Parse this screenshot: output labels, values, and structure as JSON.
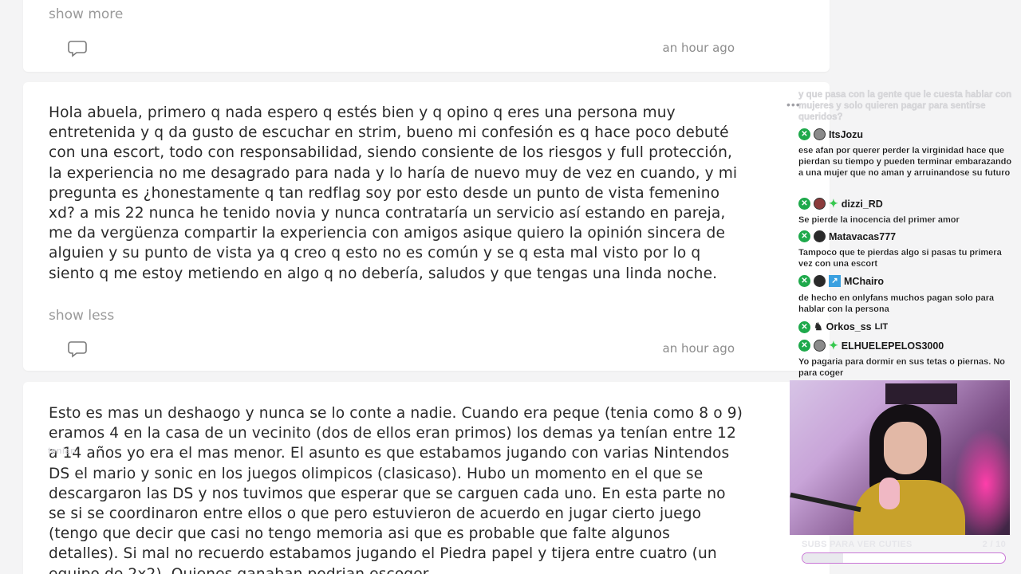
{
  "posts": [
    {
      "text": "",
      "toggle": "show more",
      "time": "an hour ago"
    },
    {
      "text": "Hola abuela, primero q nada espero q estés bien y q opino q eres una persona muy entretenida y q da gusto de escuchar en strim, bueno mi confesión es q hace poco debuté con una escort, todo con responsabilidad, siendo consiente de los riesgos y full protección, la experiencia no me desagrado para nada y lo haría de nuevo muy de vez en cuando, y mi pregunta es ¿honestamente q tan redflag soy por esto desde un punto de vista femenino xd? a mis 22 nunca he tenido novia y nunca contrataría un servicio así estando en pareja, me da vergüenza compartir la experiencia con amigos asique quiero la opinión sincera de alguien y su punto de vista ya q creo q esto no es común y se q esta mal visto por lo q siento q me estoy metiendo en algo q no debería, saludos y que tengas una linda noche.",
      "toggle": "show less",
      "time": "an hour ago"
    },
    {
      "text": "Esto es mas un deshaogo y nunca se lo conte a nadie. Cuando era peque (tenia como 8 o 9) eramos 4 en la casa de un vecinito (dos de ellos eran primos) los demas ya tenían entre 12 a 14 años yo era el mas menor. El asunto es que estabamos jugando con varias Nintendos DS el mario y sonic en los juegos olimpicos (clasicaso). Hubo un momento en el que se descargaron las DS y nos tuvimos que esperar que se carguen cada uno. En esta parte no se si se coordinaron entre ellos o que pero estuvieron de acuerdo en jugar cierto juego (tengo que decir que casi no tengo memoria asi que es probable que falte algunos detalles). Si mal no recuerdo estabamos jugando el Piedra papel y tijera entre cuatro (un equipo de 2x2). Quienes ganaban podrian escoger"
    }
  ],
  "overlay_tag": "tenían",
  "chat": {
    "faded_message": "y que pasa con la gente que le cuesta hablar con mujeres y solo quieren pagar para sentirse queridos?",
    "dots": "•••",
    "messages": [
      {
        "user": "ItsJozu",
        "text": "ese afan por querer perder la virginidad hace que pierdan su tiempo y pueden terminar embarazando a una mujer que no aman y arruinandose su futuro",
        "avatar": "gray",
        "extra": ""
      },
      {
        "user": "dizzi_RD",
        "text": "Se pierde la inocencia del primer amor",
        "avatar": "red",
        "extra": "spark"
      },
      {
        "user": "Matavacas777",
        "text": "Tampoco que te pierdas algo si pasas tu primera vez con una escort",
        "avatar": "dark",
        "extra": ""
      },
      {
        "user": "MChairo",
        "text": "de hecho en onlyfans muchos pagan solo para hablar con la persona",
        "avatar": "dark",
        "extra": "blue"
      },
      {
        "user": "Orkos_ss",
        "text": "",
        "avatar": "",
        "extra": "sil",
        "suffix": "LIT"
      },
      {
        "user": "ELHUELEPELOS3000",
        "text": "Yo pagaria para dormir en sus tetas o piernas. No para coger",
        "avatar": "gray",
        "extra": "spark"
      }
    ]
  },
  "goal": {
    "label": "SUBS PARA VER CUTIES",
    "count": "2 / 10",
    "progress": 0.2
  },
  "colors": {
    "page_bg": "#f4f4f5",
    "card_bg": "#ffffff",
    "text": "#2a2a2a",
    "muted": "#8d8d8d",
    "badge_green": "#1ea94b",
    "goal_border": "#c977d6"
  },
  "icons": {
    "comment": "comment-bubble-icon"
  }
}
